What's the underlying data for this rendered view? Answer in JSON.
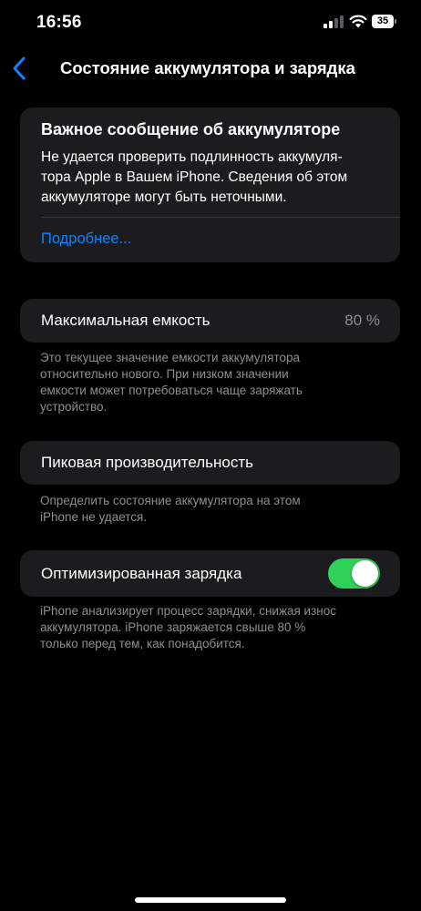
{
  "status_bar": {
    "time": "16:56",
    "battery_level": "35"
  },
  "nav": {
    "title": "Состояние аккумулятора и зарядка"
  },
  "important_message": {
    "title": "Важное сообщение об аккумуляторе",
    "line1": "Не удается проверить подлинность аккумуля-",
    "line2": "тора Apple в Вашем iPhone. Сведения об этом",
    "line3": "аккумуляторе могут быть неточными.",
    "link": "Подробнее..."
  },
  "max_capacity": {
    "label": "Максимальная емкость",
    "value": "80 %",
    "footnote_line1": "Это текущее значение емкости аккумулятора",
    "footnote_line2": "относительно нового. При низком значении",
    "footnote_line3": "емкости может потребоваться чаще заряжать",
    "footnote_line4": "устройство."
  },
  "peak_performance": {
    "label": "Пиковая производительность",
    "footnote_line1": "Определить состояние аккумулятора на этом",
    "footnote_line2": "iPhone не удается."
  },
  "optimized_charging": {
    "label": "Оптимизированная зарядка",
    "enabled": true,
    "footnote_line1": "iPhone анализирует процесс зарядки, снижая износ",
    "footnote_line2": "аккумулятора. iPhone заряжается свыше 80 %",
    "footnote_line3": "только перед тем, как понадобится."
  },
  "colors": {
    "accent": "#0a84ff",
    "toggle_on": "#30d158",
    "card": "#1c1c1e",
    "secondary_text": "#8e8e93"
  },
  "icons": [
    "back-chevron-icon",
    "signal-icon",
    "wifi-icon",
    "battery-icon"
  ]
}
